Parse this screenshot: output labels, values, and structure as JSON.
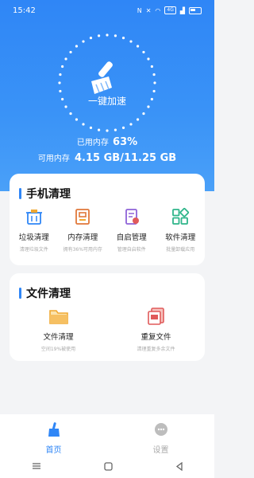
{
  "status_bar": {
    "time": "15:42",
    "network_badge": "4G"
  },
  "hero": {
    "boost_label": "一键加速",
    "mem_used_label": "已用内存",
    "mem_used_percent": "63%",
    "mem_avail_label": "可用内存",
    "mem_avail_value": "4.15 GB/11.25 GB"
  },
  "phone_clean": {
    "title": "手机清理",
    "items": [
      {
        "label": "垃圾清理",
        "sub": "清理垃圾文件",
        "icon": "trash-bin-icon"
      },
      {
        "label": "内存清理",
        "sub": "拥有36%可用内存",
        "icon": "memory-icon"
      },
      {
        "label": "自启管理",
        "sub": "管理自启软件",
        "icon": "autostart-doc-icon"
      },
      {
        "label": "软件清理",
        "sub": "批量卸载应用",
        "icon": "apps-grid-icon"
      }
    ]
  },
  "file_clean": {
    "title": "文件清理",
    "items": [
      {
        "label": "文件清理",
        "sub": "空间19%被使用",
        "icon": "folder-icon"
      },
      {
        "label": "重复文件",
        "sub": "清理重复多余文件",
        "icon": "duplicate-files-icon"
      }
    ]
  },
  "tabbar": {
    "home_label": "首页",
    "settings_label": "设置"
  },
  "colors": {
    "accent": "#2f86f6",
    "orange": "#f0a830",
    "pink": "#e05a5a",
    "purple": "#8e63d8",
    "green": "#2fb58a"
  }
}
